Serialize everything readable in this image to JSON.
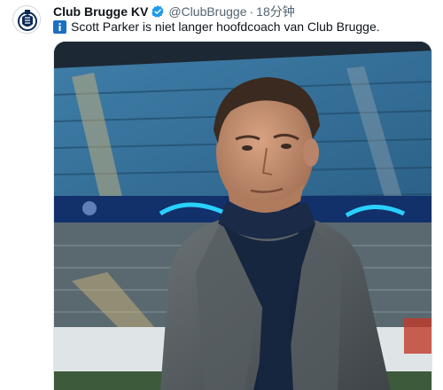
{
  "tweet": {
    "display_name": "Club Brugge KV",
    "verified": true,
    "handle": "@ClubBrugge",
    "separator": "·",
    "time": "18分钟",
    "text": "Scott Parker is niet langer hoofdcoach van Club Brugge.",
    "info_icon": "info-icon"
  },
  "media": {
    "type": "photo",
    "description_icon": "photo"
  },
  "colors": {
    "verified_blue": "#1d9bf0",
    "info_blue": "#1d6fbf",
    "muted_text": "#536471"
  }
}
